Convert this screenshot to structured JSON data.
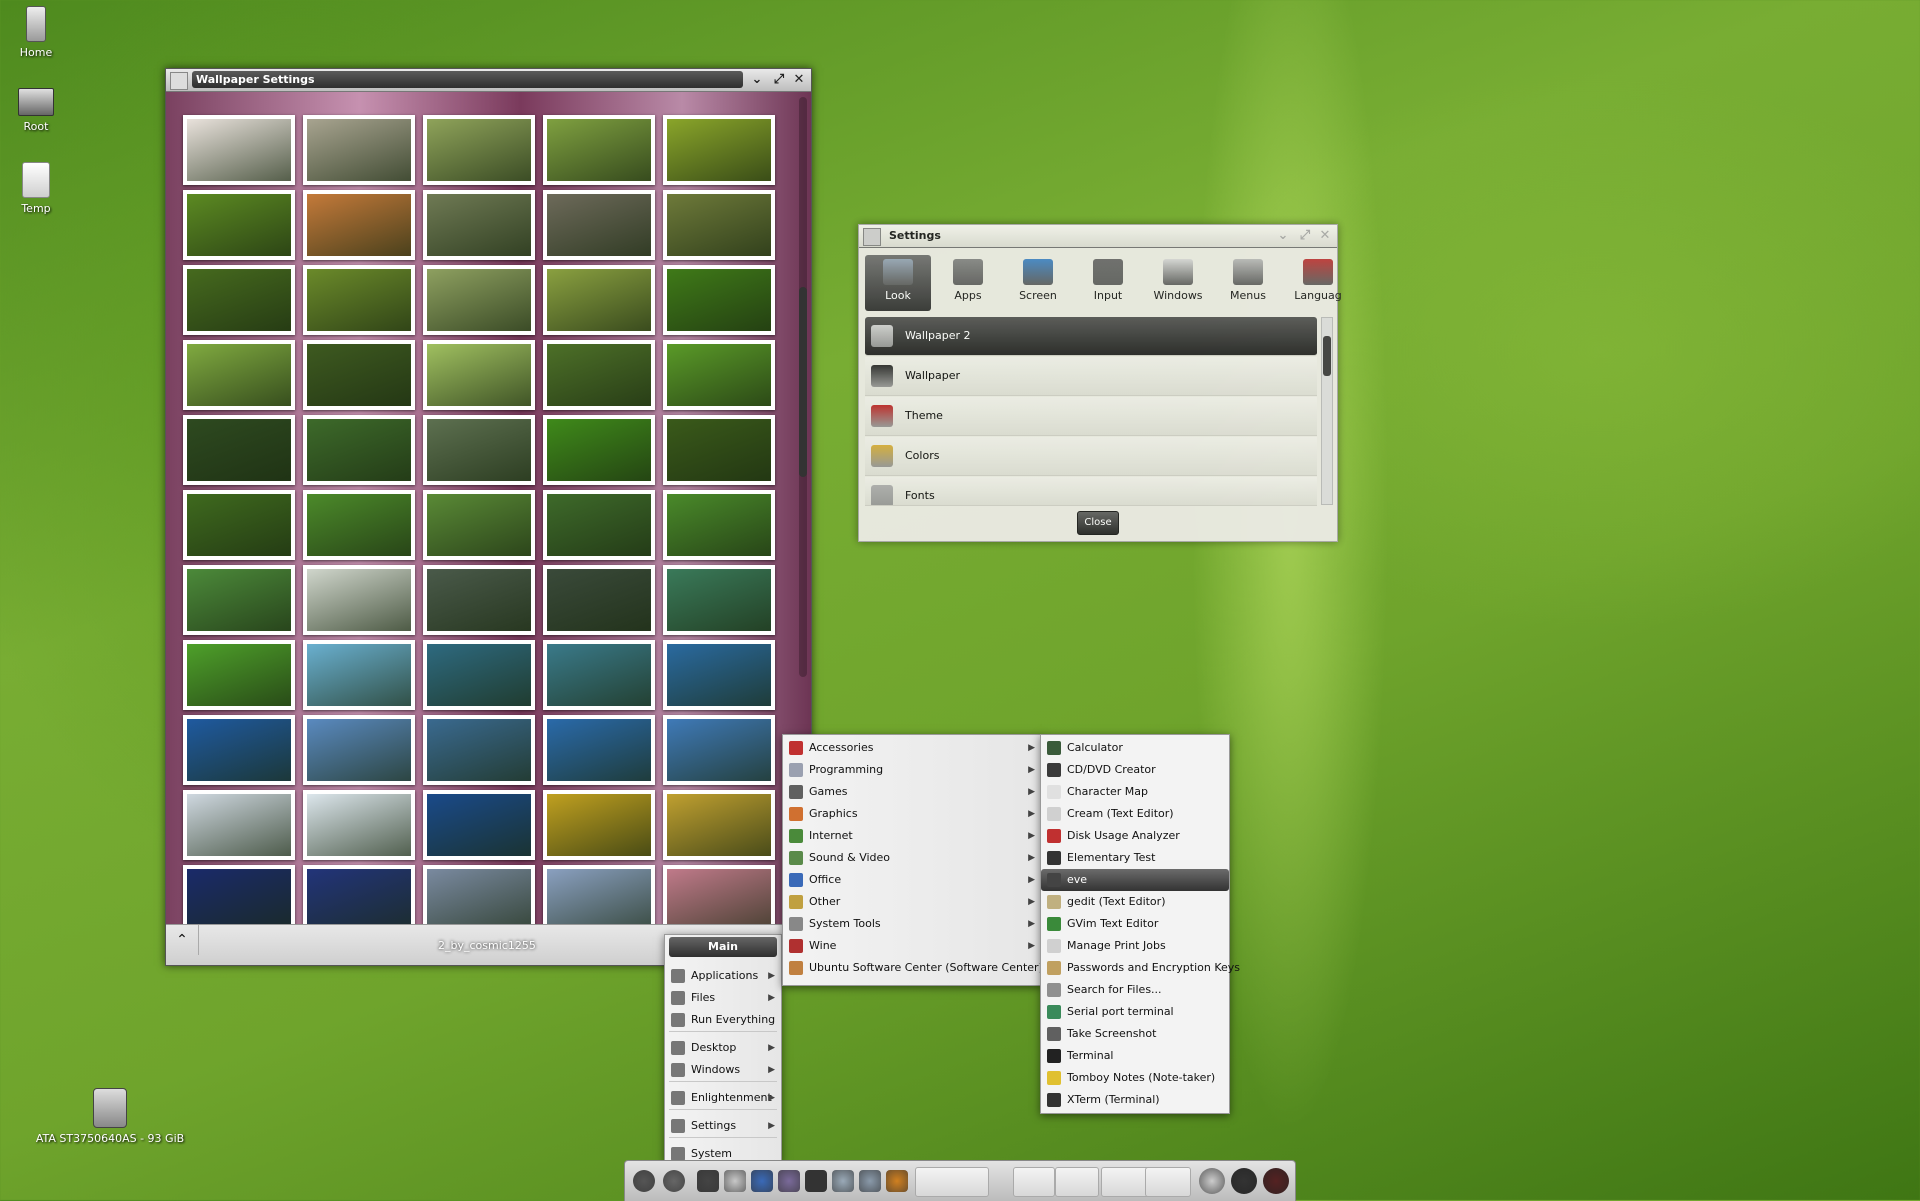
{
  "desktop": {
    "icons": [
      {
        "label": "Home",
        "icon": "trash-can-icon"
      },
      {
        "label": "Root",
        "icon": "laptop-icon"
      },
      {
        "label": "Temp",
        "icon": "folder-icon"
      },
      {
        "label": "ATA ST3750640AS - 93 GiB",
        "icon": "hard-drive-icon"
      }
    ]
  },
  "wallpaper_window": {
    "title": "Wallpaper Settings",
    "selected_filename": "2_by_cosmic1255",
    "up_button": "up-arrow-icon",
    "thumbnail_colors": [
      [
        "#e9e2dc",
        "#a8a490",
        "#8fa35a",
        "#7fa040",
        "#8aa52a"
      ],
      [
        "#5c8a22",
        "#c47a3a",
        "#6f7a54",
        "#6d6a5a",
        "#6e7a3a"
      ],
      [
        "#466a1e",
        "#6b8a2a",
        "#8ea060",
        "#8aa040",
        "#3f7a18"
      ],
      [
        "#80aa40",
        "#3e5a20",
        "#a0c060",
        "#4d7028",
        "#5a9a28"
      ],
      [
        "#2e4a20",
        "#3d6a2a",
        "#5d7050",
        "#3f8a1a",
        "#3a5a1a"
      ],
      [
        "#3f6a1e",
        "#4c8a2a",
        "#5a8a36",
        "#3e6a2a",
        "#4a8a2a"
      ],
      [
        "#4c8a3a",
        "#d0d6cc",
        "#4a5a4a",
        "#3a4a3a",
        "#3a7a5a"
      ],
      [
        "#4ea02a",
        "#6ab0d0",
        "#2e6a80",
        "#3a7a8a",
        "#2a6aa0"
      ],
      [
        "#1f5aa0",
        "#5a8ac0",
        "#3a6a90",
        "#2a6aaa",
        "#3f7ab8"
      ],
      [
        "#cfd8e0",
        "#dce6ec",
        "#1a4a8a",
        "#c0a020",
        "#c0a030"
      ],
      [
        "#1a2a6a",
        "#22347a",
        "#7a8aa0",
        "#8aa0c0",
        "#c07a8a"
      ]
    ]
  },
  "settings_window": {
    "title": "Settings",
    "close_label": "Close",
    "categories": [
      {
        "label": "Look",
        "icon": "look-icon",
        "color": "#9aa8b8"
      },
      {
        "label": "Apps",
        "icon": "gear-icon",
        "color": "#8a8a8a"
      },
      {
        "label": "Screen",
        "icon": "monitor-icon",
        "color": "#4a8ac8"
      },
      {
        "label": "Input",
        "icon": "keyboard-icon",
        "color": "#707070"
      },
      {
        "label": "Windows",
        "icon": "window-icon",
        "color": "#d8d8d8"
      },
      {
        "label": "Menus",
        "icon": "menu-icon",
        "color": "#bbbbbb"
      },
      {
        "label": "Languag",
        "icon": "flag-icon",
        "color": "#c04040"
      }
    ],
    "items": [
      {
        "label": "Wallpaper 2",
        "icon": "wallpaper-icon",
        "color": "#d0d0d0"
      },
      {
        "label": "Wallpaper",
        "icon": "wallpaper-icon",
        "color": "#333333"
      },
      {
        "label": "Theme",
        "icon": "paint-bucket-icon",
        "color": "#c03030"
      },
      {
        "label": "Colors",
        "icon": "palette-icon",
        "color": "#d8b040"
      },
      {
        "label": "Fonts",
        "icon": "font-icon",
        "color": "#b0b0b0"
      }
    ]
  },
  "main_menu": {
    "title": "Main",
    "items": [
      {
        "label": "Applications",
        "icon": "gear-icon",
        "submenu": true
      },
      {
        "label": "Files",
        "icon": "folder-icon",
        "submenu": true
      },
      {
        "label": "Run Everything",
        "icon": "terminal-icon",
        "submenu": false
      },
      {
        "label": "Desktop",
        "icon": "desktop-icon",
        "submenu": true
      },
      {
        "label": "Windows",
        "icon": "window-icon",
        "submenu": true
      },
      {
        "label": "Enlightenment",
        "icon": "enlightenment-icon",
        "submenu": true
      },
      {
        "label": "Settings",
        "icon": "settings-icon",
        "submenu": true
      },
      {
        "label": "System",
        "icon": "system-icon",
        "submenu": false
      }
    ]
  },
  "applications_menu": {
    "items": [
      {
        "label": "Accessories",
        "icon": "accessories-icon",
        "color": "#c03030"
      },
      {
        "label": "Programming",
        "icon": "programming-icon",
        "color": "#9aa0b0"
      },
      {
        "label": "Games",
        "icon": "games-icon",
        "color": "#606060"
      },
      {
        "label": "Graphics",
        "icon": "graphics-icon",
        "color": "#d07030"
      },
      {
        "label": "Internet",
        "icon": "globe-icon",
        "color": "#4a8a3a"
      },
      {
        "label": "Sound & Video",
        "icon": "sound-video-icon",
        "color": "#5a8a4a"
      },
      {
        "label": "Office",
        "icon": "office-icon",
        "color": "#3a6ab8"
      },
      {
        "label": "Other",
        "icon": "other-icon",
        "color": "#c0a040"
      },
      {
        "label": "System Tools",
        "icon": "system-tools-icon",
        "color": "#888888"
      },
      {
        "label": "Wine",
        "icon": "wine-icon",
        "color": "#b03030"
      },
      {
        "label": "Ubuntu Software Center (Software Center)",
        "icon": "software-center-icon",
        "color": "#c08040"
      }
    ]
  },
  "accessories_menu": {
    "items": [
      {
        "label": "Calculator",
        "icon": "calculator-icon",
        "color": "#3a5a3a"
      },
      {
        "label": "CD/DVD Creator",
        "icon": "disc-icon",
        "color": "#3a3a3a"
      },
      {
        "label": "Character Map",
        "icon": "character-map-icon",
        "color": "#e0e0e0"
      },
      {
        "label": "Cream (Text Editor)",
        "icon": "cream-icon",
        "color": "#d0d0d0"
      },
      {
        "label": "Disk Usage Analyzer",
        "icon": "disk-usage-icon",
        "color": "#c03030"
      },
      {
        "label": "Elementary Test",
        "icon": "elementary-icon",
        "color": "#333333"
      },
      {
        "label": "eve",
        "icon": "eve-icon",
        "color": "#444444",
        "selected": true
      },
      {
        "label": "gedit (Text Editor)",
        "icon": "gedit-icon",
        "color": "#c0b080"
      },
      {
        "label": "GVim Text Editor",
        "icon": "vim-icon",
        "color": "#3a8a3a"
      },
      {
        "label": "Manage Print Jobs",
        "icon": "printer-icon",
        "color": "#d0d0d0"
      },
      {
        "label": "Passwords and Encryption Keys",
        "icon": "keys-icon",
        "color": "#c0a060"
      },
      {
        "label": "Search for Files...",
        "icon": "search-icon",
        "color": "#909090"
      },
      {
        "label": "Serial port terminal",
        "icon": "serial-icon",
        "color": "#3a8a5a"
      },
      {
        "label": "Take Screenshot",
        "icon": "camera-icon",
        "color": "#606060"
      },
      {
        "label": "Terminal",
        "icon": "terminal-icon",
        "color": "#222222"
      },
      {
        "label": "Tomboy Notes (Note-taker)",
        "icon": "note-icon",
        "color": "#e0c030"
      },
      {
        "label": "XTerm (Terminal)",
        "icon": "xterm-icon",
        "color": "#333333"
      }
    ]
  },
  "shelf": {
    "items": [
      {
        "icon": "start-icon",
        "color": "#555555"
      },
      {
        "icon": "search-icon",
        "color": "#666666"
      },
      {
        "icon": "desktop-switch-icon",
        "color": "#444444"
      },
      {
        "icon": "mail-icon",
        "color": "#c8c8c8"
      },
      {
        "icon": "globe-icon",
        "color": "#3a6ab8"
      },
      {
        "icon": "pidgin-icon",
        "color": "#7a6a9a"
      },
      {
        "icon": "inkscape-icon",
        "color": "#333333"
      },
      {
        "icon": "package-icon",
        "color": "#9aaab8"
      },
      {
        "icon": "network-icon",
        "color": "#8a9aaa"
      },
      {
        "icon": "tools-icon",
        "color": "#d08020"
      }
    ],
    "tray": [
      {
        "icon": "wifi-icon",
        "color": "#cccccc"
      },
      {
        "icon": "clock-icon",
        "color": "#333333"
      },
      {
        "icon": "battery-gauge-icon",
        "color": "#552222"
      }
    ]
  }
}
